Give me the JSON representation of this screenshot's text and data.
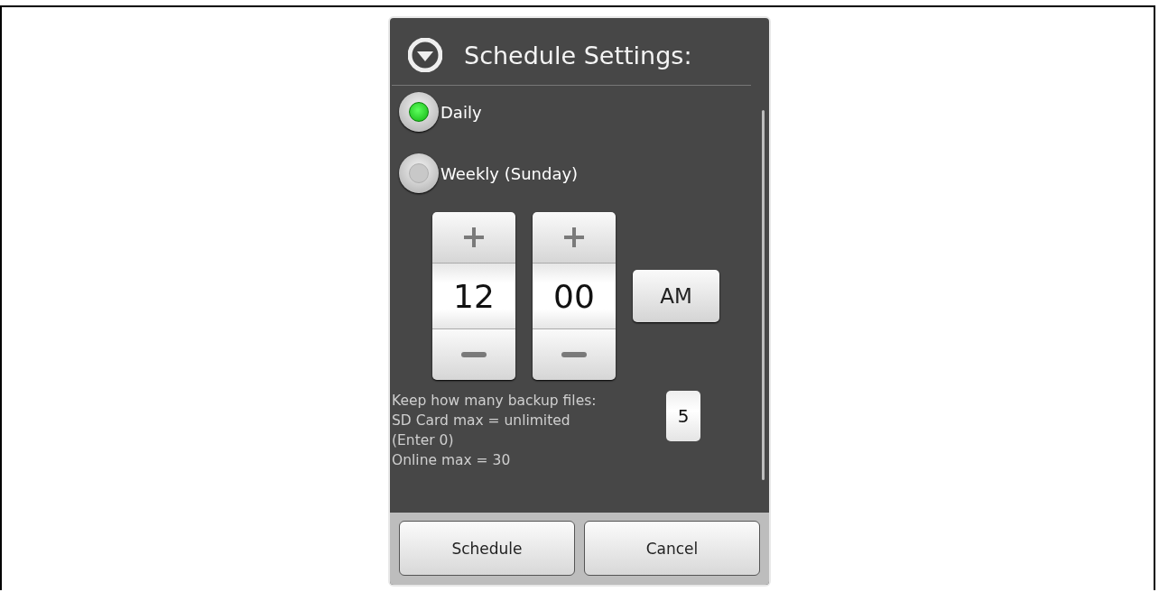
{
  "dialog": {
    "title": "Schedule Settings:",
    "options": [
      {
        "label": "Daily",
        "selected": true
      },
      {
        "label": "Weekly (Sunday)",
        "selected": false
      }
    ],
    "time": {
      "hour": "12",
      "minute": "00",
      "period": "AM"
    },
    "keep_files": {
      "lines": [
        "Keep how many backup files:",
        "SD Card max = unlimited",
        "(Enter 0)",
        "Online max = 30"
      ],
      "value": "5"
    },
    "buttons": [
      "Schedule",
      "Cancel"
    ]
  }
}
